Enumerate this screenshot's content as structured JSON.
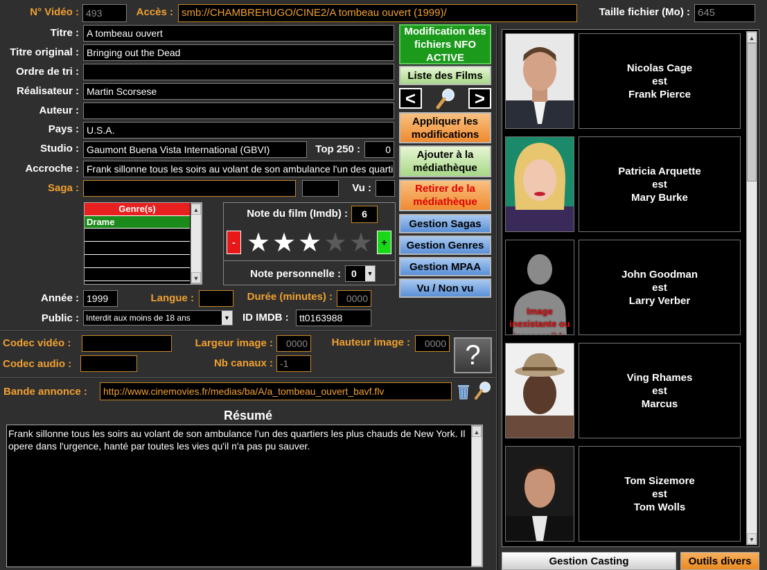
{
  "header": {
    "video_no_label": "N° Vidéo :",
    "video_no_value": "493",
    "access_label": "Accès :",
    "access_value": "smb://CHAMBREHUGO/CINE2/A tombeau ouvert (1999)/",
    "file_size_label": "Taille fichier (Mo) :",
    "file_size_value": "645"
  },
  "fields": {
    "titre_label": "Titre :",
    "titre_value": "A tombeau ouvert",
    "titre_original_label": "Titre original :",
    "titre_original_value": "Bringing out the Dead",
    "ordre_tri_label": "Ordre de tri :",
    "ordre_tri_value": "",
    "realisateur_label": "Réalisateur :",
    "realisateur_value": "Martin Scorsese",
    "auteur_label": "Auteur :",
    "auteur_value": "",
    "pays_label": "Pays :",
    "pays_value": "U.S.A.",
    "studio_label": "Studio :",
    "studio_value": "Gaumont Buena Vista International (GBVI)",
    "top250_label": "Top 250 :",
    "top250_value": "0",
    "accroche_label": "Accroche :",
    "accroche_value": "Frank sillonne tous les soirs au volant de son ambulance l'un des quartiers les plus chauds de New York.",
    "saga_label": "Saga :",
    "saga_value": "",
    "saga_no_value": "",
    "vu_label": "Vu :",
    "vu_value": ""
  },
  "genres": {
    "header": "Genre(s)",
    "items": [
      "Drame",
      "",
      "",
      "",
      "",
      ""
    ]
  },
  "rating": {
    "imdb_label": "Note du film (Imdb) :",
    "imdb_value": "6",
    "minus": "-",
    "plus": "+",
    "stars_filled": 3,
    "stars_total": 5,
    "personal_label": "Note personnelle :",
    "personal_value": "0"
  },
  "details": {
    "annee_label": "Année :",
    "annee_value": "1999",
    "langue_label": "Langue :",
    "langue_value": "",
    "duree_label": "Durée (minutes) :",
    "duree_value": "0000",
    "public_label": "Public :",
    "public_value": "Interdit aux moins de 18 ans",
    "imdb_id_label": "ID IMDB :",
    "imdb_id_value": "tt0163988"
  },
  "tech": {
    "codec_video_label": "Codec vidéo :",
    "codec_video_value": "",
    "codec_audio_label": "Codec audio :",
    "codec_audio_value": "",
    "largeur_label": "Largeur image :",
    "largeur_value": "0000",
    "hauteur_label": "Hauteur image :",
    "hauteur_value": "0000",
    "canaux_label": "Nb canaux :",
    "canaux_value": "-1",
    "help_glyph": "?"
  },
  "trailer": {
    "label": "Bande annonce :",
    "value": "http://www.cinemovies.fr/medias/ba/A/a_tombeau_ouvert_bavf.flv"
  },
  "resume": {
    "title": "Résumé",
    "text": "Frank sillonne tous les soirs au volant de son ambulance l'un des quartiers les plus chauds de New York. Il opere dans l'urgence, hanté par toutes les vies qu'il n'a pas pu sauver."
  },
  "buttons": {
    "nfo": "Modification des fichiers NFO ACTIVE",
    "film_list": "Liste des Films",
    "prev": "<",
    "next": ">",
    "apply": "Appliquer les modifications",
    "add": "Ajouter à la médiathèque",
    "remove": "Retirer de la médiathèque",
    "sagas": "Gestion Sagas",
    "genres": "Gestion Genres",
    "mpaa": "Gestion MPAA",
    "seen": "Vu / Non vu"
  },
  "cast": [
    {
      "actor": "Nicolas Cage",
      "est": "est",
      "role": "Frank Pierce",
      "photo_missing": false
    },
    {
      "actor": "Patricia Arquette",
      "est": "est",
      "role": "Mary Burke",
      "photo_missing": false
    },
    {
      "actor": "John Goodman",
      "est": "est",
      "role": "Larry Verber",
      "photo_missing": true,
      "missing_text": "Image inexistante ou inaccessible"
    },
    {
      "actor": "Ving Rhames",
      "est": "est",
      "role": "Marcus",
      "photo_missing": false
    },
    {
      "actor": "Tom Sizemore",
      "est": "est",
      "role": "Tom Wolls",
      "photo_missing": false
    }
  ],
  "tabs": {
    "casting": "Gestion Casting",
    "tools": "Outils divers"
  },
  "colors": {
    "background": "#2f2f2f",
    "label_orange": "#f0a030",
    "nfo_green": "#1c9a1c",
    "genre_header_red": "#e82020",
    "genre_selected_green": "#1a8a1a"
  }
}
